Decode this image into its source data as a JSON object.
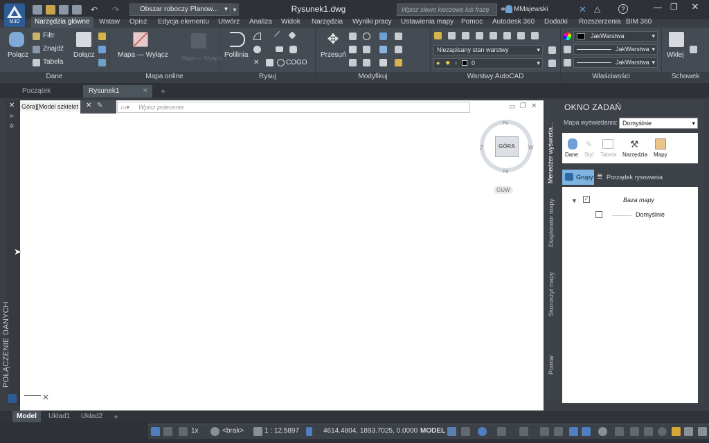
{
  "app": {
    "logo": "M3D",
    "title": "Rysunek1.dwg",
    "workspace": "Obszar roboczy Planow...",
    "search_placeholder": "Wpisz słowo kluczowe lub frazę",
    "user": "MMajewski"
  },
  "ribbon_tabs": [
    "Narzędzia główne",
    "Wstaw",
    "Opisz",
    "Edycja elementu",
    "Utwórz",
    "Analiza",
    "Widok",
    "Narzędzia",
    "Wyniki pracy",
    "Ustawienia mapy",
    "Pomoc",
    "Autodesk 360",
    "Dodatki",
    "Rozszerzenia",
    "BIM 360"
  ],
  "panels": {
    "dane": {
      "title": "Dane",
      "polacz": "Połącz",
      "filtr": "Filtr",
      "znajdz": "Znajdź",
      "tabela": "Tabela",
      "dolacz": "Dołącz"
    },
    "mapa": {
      "title": "Mapa online",
      "wylacz": "Mapa — Wyłącz",
      "bg": "Mapa — Wyłącz..."
    },
    "rysuj": {
      "title": "Rysuj",
      "polilinia": "Polilinia",
      "cogo": "COGO"
    },
    "modyfikuj": {
      "title": "Modyfikuj",
      "przesun": "Przesuń"
    },
    "warstwy": {
      "title": "Warstwy AutoCAD",
      "state": "Niezapisany stan warstwy",
      "layer": "0"
    },
    "wlasciwosci": {
      "title": "Właściwości",
      "color": "JakWarstwa",
      "linetype": "JakWarstwa",
      "lineweight": "JakWarstwa"
    },
    "schowek": {
      "title": "Schowek",
      "wklej": "Wklej"
    }
  },
  "doc_tabs": [
    "Początek",
    "Rysunek1"
  ],
  "left_palette": {
    "title": "POŁĄCZENIE DANYCH"
  },
  "canvas": {
    "view_label": "Góra][Model szkielet",
    "cmd_placeholder": "Wpisz polecenie",
    "viewcube_top": "GÓRA",
    "compass_n": "Pn",
    "compass_s": "Pd",
    "compass_e": "W",
    "compass_w": "Z",
    "ucs": "GUW"
  },
  "side_tabs": [
    "Menedżer wyświetla...",
    "Eksplorator mapy",
    "Skoroszyt mapy",
    "Pomiar"
  ],
  "task_pane": {
    "title": "OKNO ZADAŃ",
    "map_display_label": "Mapa wyświetlania:",
    "map_display_value": "Domyślnie",
    "tools": [
      "Dane",
      "Styl",
      "Tabela",
      "Narzędzia",
      "Mapy"
    ],
    "grupy": "Grupy",
    "porzadek": "Porządek rysowania",
    "tree_root": "Baza mapy",
    "tree_child": "Domyślnie"
  },
  "layout_tabs": [
    "Model",
    "Układ1",
    "Układ2"
  ],
  "status": {
    "scale_ratio": "1x",
    "coord_sys": "<brak>",
    "scale": "1 : 12.5897",
    "coords": "4614.4804, 1893.7025, 0.0000",
    "space": "MODEL"
  }
}
